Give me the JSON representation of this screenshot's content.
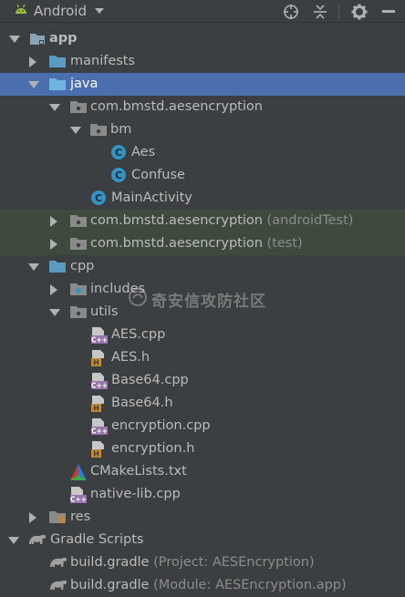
{
  "toolbar": {
    "view_mode": "Android",
    "icons": [
      "android-icon",
      "caret-down-icon",
      "crosshair-icon",
      "collapse-all-icon",
      "gear-icon",
      "hide-panel-icon"
    ]
  },
  "tree": {
    "app": "app",
    "manifests": "manifests",
    "java": "java",
    "pkg_main": "com.bmstd.aesencryption",
    "bm": "bm",
    "aes": "Aes",
    "confuse": "Confuse",
    "main_activity": "MainActivity",
    "pkg_android_test": "com.bmstd.aesencryption",
    "pkg_android_test_suffix": "(androidTest)",
    "pkg_test": "com.bmstd.aesencryption",
    "pkg_test_suffix": "(test)",
    "cpp": "cpp",
    "includes": "includes",
    "utils": "utils",
    "aes_cpp": "AES.cpp",
    "aes_h": "AES.h",
    "base64_cpp": "Base64.cpp",
    "base64_h": "Base64.h",
    "encryption_cpp": "encryption.cpp",
    "encryption_h": "encryption.h",
    "cmakelists": "CMakeLists.txt",
    "native_lib": "native-lib.cpp",
    "res": "res",
    "gradle_scripts": "Gradle Scripts",
    "build_gradle_project": "build.gradle",
    "build_gradle_project_suffix": "(Project: AESEncryption)",
    "build_gradle_module": "build.gradle",
    "build_gradle_module_suffix": "(Module: AESEncryption.app)"
  },
  "watermark": "奇安信攻防社区",
  "colors": {
    "background": "#3c3f41",
    "selection": "#4b6eaf",
    "test_highlight": "#3e4a3e",
    "text": "#bbbbbb",
    "suffix": "#8c8c8c",
    "folder": "#5b9bc1",
    "class_icon": "#3592c4",
    "cpp_icon": "#9876aa",
    "header_icon": "#c08b3a",
    "android_green": "#9ac33c"
  }
}
